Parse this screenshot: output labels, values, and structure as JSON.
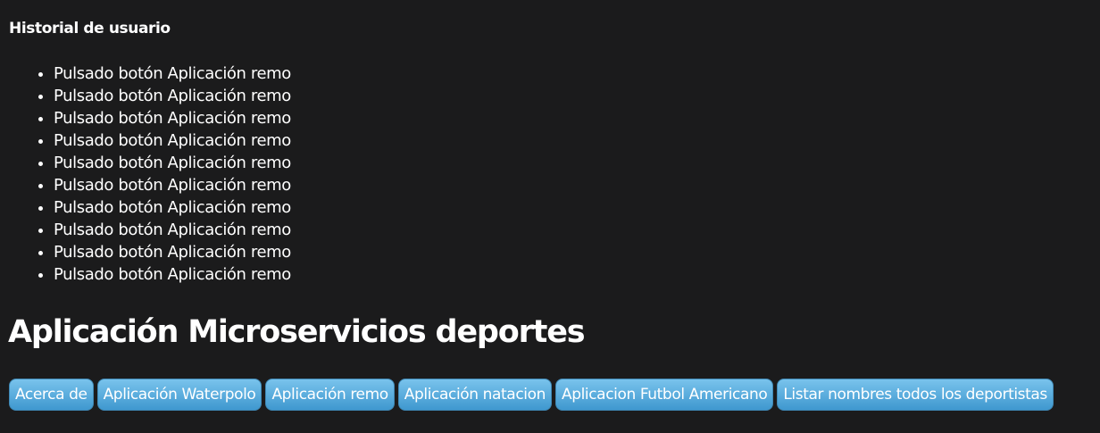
{
  "history": {
    "title": "Historial de usuario",
    "items": [
      "Pulsado botón Aplicación remo",
      "Pulsado botón Aplicación remo",
      "Pulsado botón Aplicación remo",
      "Pulsado botón Aplicación remo",
      "Pulsado botón Aplicación remo",
      "Pulsado botón Aplicación remo",
      "Pulsado botón Aplicación remo",
      "Pulsado botón Aplicación remo",
      "Pulsado botón Aplicación remo",
      "Pulsado botón Aplicación remo"
    ]
  },
  "app": {
    "title": "Aplicación Microservicios deportes"
  },
  "nav": {
    "buttons": [
      "Acerca de",
      "Aplicación Waterpolo",
      "Aplicación remo",
      "Aplicación natacion",
      "Aplicacion Futbol Americano",
      "Listar nombres todos los deportistas"
    ]
  },
  "colors": {
    "background": "#1b1b1c",
    "text": "#ffffff",
    "button_top": "#79c3ec",
    "button_bottom": "#3f98cf"
  }
}
